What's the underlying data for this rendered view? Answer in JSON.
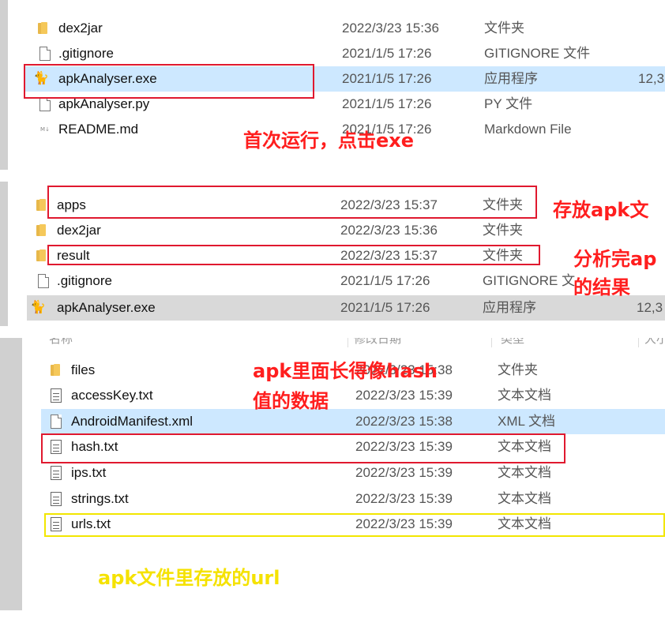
{
  "panel1": {
    "rows": [
      {
        "name": "dex2jar",
        "date": "2022/3/23 15:36",
        "type": "文件夹",
        "size": "",
        "icon": "folder-icon"
      },
      {
        "name": ".gitignore",
        "date": "2021/1/5 17:26",
        "type": "GITIGNORE 文件",
        "size": "",
        "icon": "file-icon"
      },
      {
        "name": "apkAnalyser.exe",
        "date": "2021/1/5 17:26",
        "type": "应用程序",
        "size": "12,3",
        "icon": "exe-icon"
      },
      {
        "name": "apkAnalyser.py",
        "date": "2021/1/5 17:26",
        "type": "PY 文件",
        "size": "",
        "icon": "file-icon"
      },
      {
        "name": "README.md",
        "date": "2021/1/5 17:26",
        "type": "Markdown File",
        "size": "",
        "icon": "md-icon"
      }
    ],
    "annotation": "首次运行，点击exe"
  },
  "panel2": {
    "rows": [
      {
        "name": "apps",
        "date": "2022/3/23 15:37",
        "type": "文件夹",
        "size": "",
        "icon": "folder-icon"
      },
      {
        "name": "dex2jar",
        "date": "2022/3/23 15:36",
        "type": "文件夹",
        "size": "",
        "icon": "folder-icon"
      },
      {
        "name": "result",
        "date": "2022/3/23 15:37",
        "type": "文件夹",
        "size": "",
        "icon": "folder-icon"
      },
      {
        "name": ".gitignore",
        "date": "2021/1/5 17:26",
        "type": "GITIGNORE 文",
        "size": "",
        "icon": "file-icon"
      },
      {
        "name": "apkAnalyser.exe",
        "date": "2021/1/5 17:26",
        "type": "应用程序",
        "size": "12,3",
        "icon": "exe-icon"
      }
    ],
    "annotation_apps": "存放apk文",
    "annotation_result_1": "分析完ap",
    "annotation_result_2": "的结果"
  },
  "panel3": {
    "header": {
      "name": "名称",
      "date": "修改日期",
      "type": "类型",
      "size": "大小"
    },
    "rows": [
      {
        "name": "files",
        "date": "2022/3/23 15:38",
        "type": "文件夹",
        "icon": "folder-icon"
      },
      {
        "name": "accessKey.txt",
        "date": "2022/3/23 15:39",
        "type": "文本文档",
        "icon": "text-file-icon"
      },
      {
        "name": "AndroidManifest.xml",
        "date": "2022/3/23 15:38",
        "type": "XML 文档",
        "icon": "file-icon"
      },
      {
        "name": "hash.txt",
        "date": "2022/3/23 15:39",
        "type": "文本文档",
        "icon": "text-file-icon"
      },
      {
        "name": "ips.txt",
        "date": "2022/3/23 15:39",
        "type": "文本文档",
        "icon": "text-file-icon"
      },
      {
        "name": "strings.txt",
        "date": "2022/3/23 15:39",
        "type": "文本文档",
        "icon": "text-file-icon"
      },
      {
        "name": "urls.txt",
        "date": "2022/3/23 15:39",
        "type": "文本文档",
        "icon": "text-file-icon"
      }
    ],
    "annotation_hash_1": "apk里面长得像hash",
    "annotation_hash_2": "值的数据",
    "annotation_url": "apk文件里存放的url"
  },
  "colors": {
    "annotation_red": "#ff1e1e",
    "annotation_yellow": "#f5e200",
    "selected_row": "#cde8ff",
    "folder": "#f5c85a"
  }
}
